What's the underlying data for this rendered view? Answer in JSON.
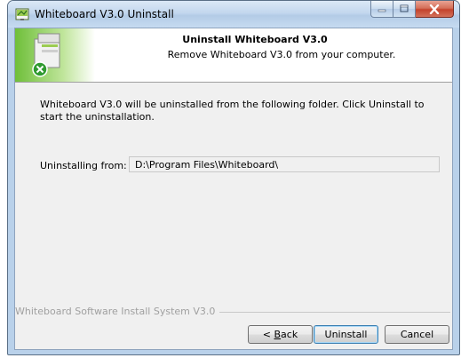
{
  "window": {
    "title": "Whiteboard V3.0 Uninstall"
  },
  "header": {
    "title": "Uninstall Whiteboard V3.0",
    "subtitle": "Remove Whiteboard V3.0 from your computer."
  },
  "body": {
    "intro": "Whiteboard V3.0 will be uninstalled from the following folder. Click Uninstall to start the uninstallation.",
    "from_label": "Uninstalling from:",
    "folder": "D:\\Program Files\\Whiteboard\\"
  },
  "branding": "Whiteboard Software Install System V3.0",
  "buttons": {
    "back_prefix": "< ",
    "back_label": "Back",
    "uninstall": "Uninstall",
    "cancel": "Cancel"
  },
  "icons": {
    "app": "whiteboard-app-icon",
    "header": "uninstall-box-icon"
  },
  "colors": {
    "close_button": "#c4432c",
    "header_bg": "#ffffff",
    "dialog_bg": "#f0f0f0"
  }
}
